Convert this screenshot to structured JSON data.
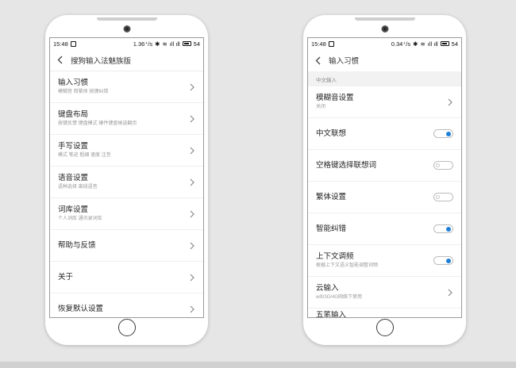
{
  "status": {
    "time": "15:48",
    "left_phone_speed": "1.36⁺/s",
    "right_phone_speed": "0.34⁺/s",
    "signal": "ıll ıll",
    "battery": "54"
  },
  "left": {
    "title": "搜狗输入法魅族版",
    "items": [
      {
        "title": "输入习惯",
        "sub": "模糊音 简繁体 按键纠错"
      },
      {
        "title": "键盘布局",
        "sub": "按键反馈 键盘模式 硬件键盘候选翻页"
      },
      {
        "title": "手写设置",
        "sub": "模式 笔迹 粗细 速度 注音"
      },
      {
        "title": "语音设置",
        "sub": "语种选择 离线语音"
      },
      {
        "title": "词库设置",
        "sub": "个人词库 通讯录词库"
      },
      {
        "title": "帮助与反馈",
        "sub": ""
      },
      {
        "title": "关于",
        "sub": ""
      },
      {
        "title": "恢复默认设置",
        "sub": ""
      }
    ]
  },
  "right": {
    "title": "输入习惯",
    "section": "中文输入",
    "items": [
      {
        "title": "模糊音设置",
        "sub": "关闭",
        "control": "chevron"
      },
      {
        "title": "中文联想",
        "sub": "",
        "control": "toggle",
        "on": true
      },
      {
        "title": "空格键选择联想词",
        "sub": "",
        "control": "toggle",
        "on": false
      },
      {
        "title": "繁体设置",
        "sub": "",
        "control": "toggle",
        "on": false
      },
      {
        "title": "智能纠错",
        "sub": "",
        "control": "toggle",
        "on": true
      },
      {
        "title": "上下文调频",
        "sub": "根据上下文语义智能调整词频",
        "control": "toggle",
        "on": true
      },
      {
        "title": "云输入",
        "sub": "wifi/3G/4G网络下使用",
        "control": "chevron"
      }
    ],
    "cutoff_item": "五笔输入"
  },
  "colors": {
    "accent": "#1e7fd8",
    "background": "#e6e6e6"
  }
}
